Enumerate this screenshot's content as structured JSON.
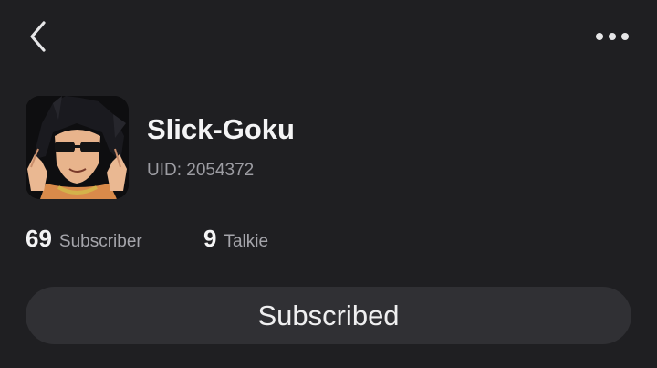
{
  "header": {
    "back_icon": "chevron-left-icon",
    "more_icon": "more-horizontal-icon"
  },
  "profile": {
    "avatar": "anime-character-avatar",
    "name": "Slick-Goku",
    "uid": "UID: 2054372"
  },
  "stats": {
    "subscribers": {
      "count": "69",
      "label": "Subscriber"
    },
    "talkies": {
      "count": "9",
      "label": "Talkie"
    }
  },
  "actions": {
    "subscribe_label": "Subscribed"
  },
  "colors": {
    "background": "#1f1f22",
    "button": "#303034",
    "secondary_text": "#9d9da3"
  }
}
